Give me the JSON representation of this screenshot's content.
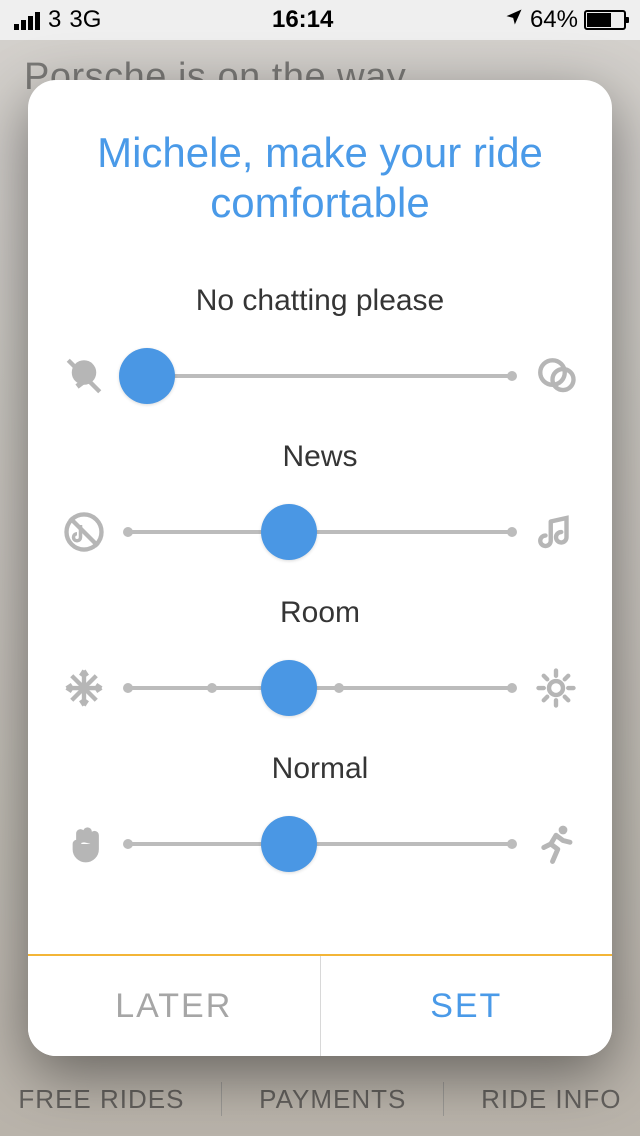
{
  "statusbar": {
    "carrier": "3",
    "network": "3G",
    "time": "16:14",
    "battery_percent": "64%"
  },
  "background": {
    "headline": "Porsche is on the way"
  },
  "modal": {
    "title": "Michele, make your ride comfortable",
    "preferences": [
      {
        "label": "No chatting please",
        "value_percent": 5,
        "ticks": [
          0,
          100
        ],
        "left_icon": "no-chat-icon",
        "right_icon": "chat-icon"
      },
      {
        "label": "News",
        "value_percent": 42,
        "ticks": [
          0,
          100
        ],
        "left_icon": "no-music-icon",
        "right_icon": "music-icon"
      },
      {
        "label": "Room",
        "value_percent": 42,
        "ticks": [
          0,
          22,
          55,
          100
        ],
        "left_icon": "snowflake-icon",
        "right_icon": "sun-icon"
      },
      {
        "label": "Normal",
        "value_percent": 42,
        "ticks": [
          0,
          100
        ],
        "left_icon": "hand-icon",
        "right_icon": "running-icon"
      }
    ],
    "actions": {
      "later": "LATER",
      "set": "SET"
    }
  },
  "bottom_tabs": {
    "left": "FREE RIDES",
    "center": "PAYMENTS",
    "right": "RIDE INFO"
  }
}
